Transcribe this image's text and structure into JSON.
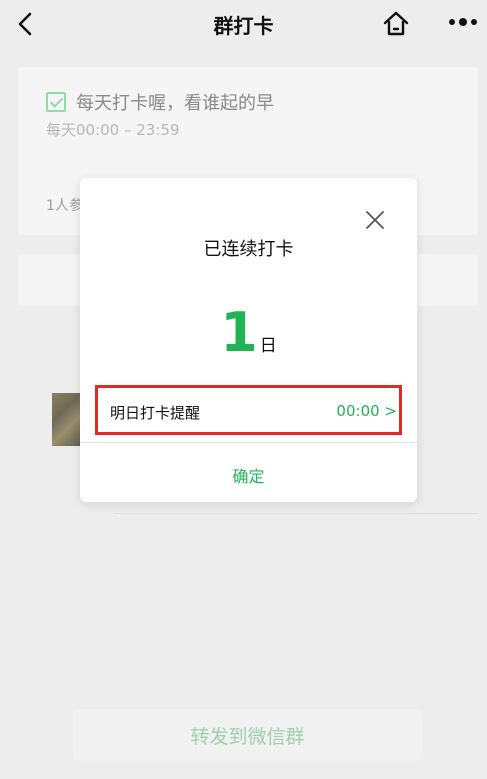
{
  "topbar": {
    "title": "群打卡",
    "icons": [
      "back-chevron-icon",
      "home-icon",
      "more-icon"
    ]
  },
  "task": {
    "title": "每天打卡喔，看谁起的早",
    "time_range": "每天00:00 – 23:59",
    "participants": "1人参"
  },
  "modal": {
    "title": "已连续打卡",
    "streak_count": "1",
    "streak_unit": "日",
    "reminder_label": "明日打卡提醒",
    "reminder_time": "00:00 >",
    "confirm_label": "确定"
  },
  "footer": {
    "forward_label": "转发到微信群"
  },
  "colors": {
    "accent_green": "#22b357",
    "highlight_red": "#e8262a",
    "background": "#ededed"
  }
}
